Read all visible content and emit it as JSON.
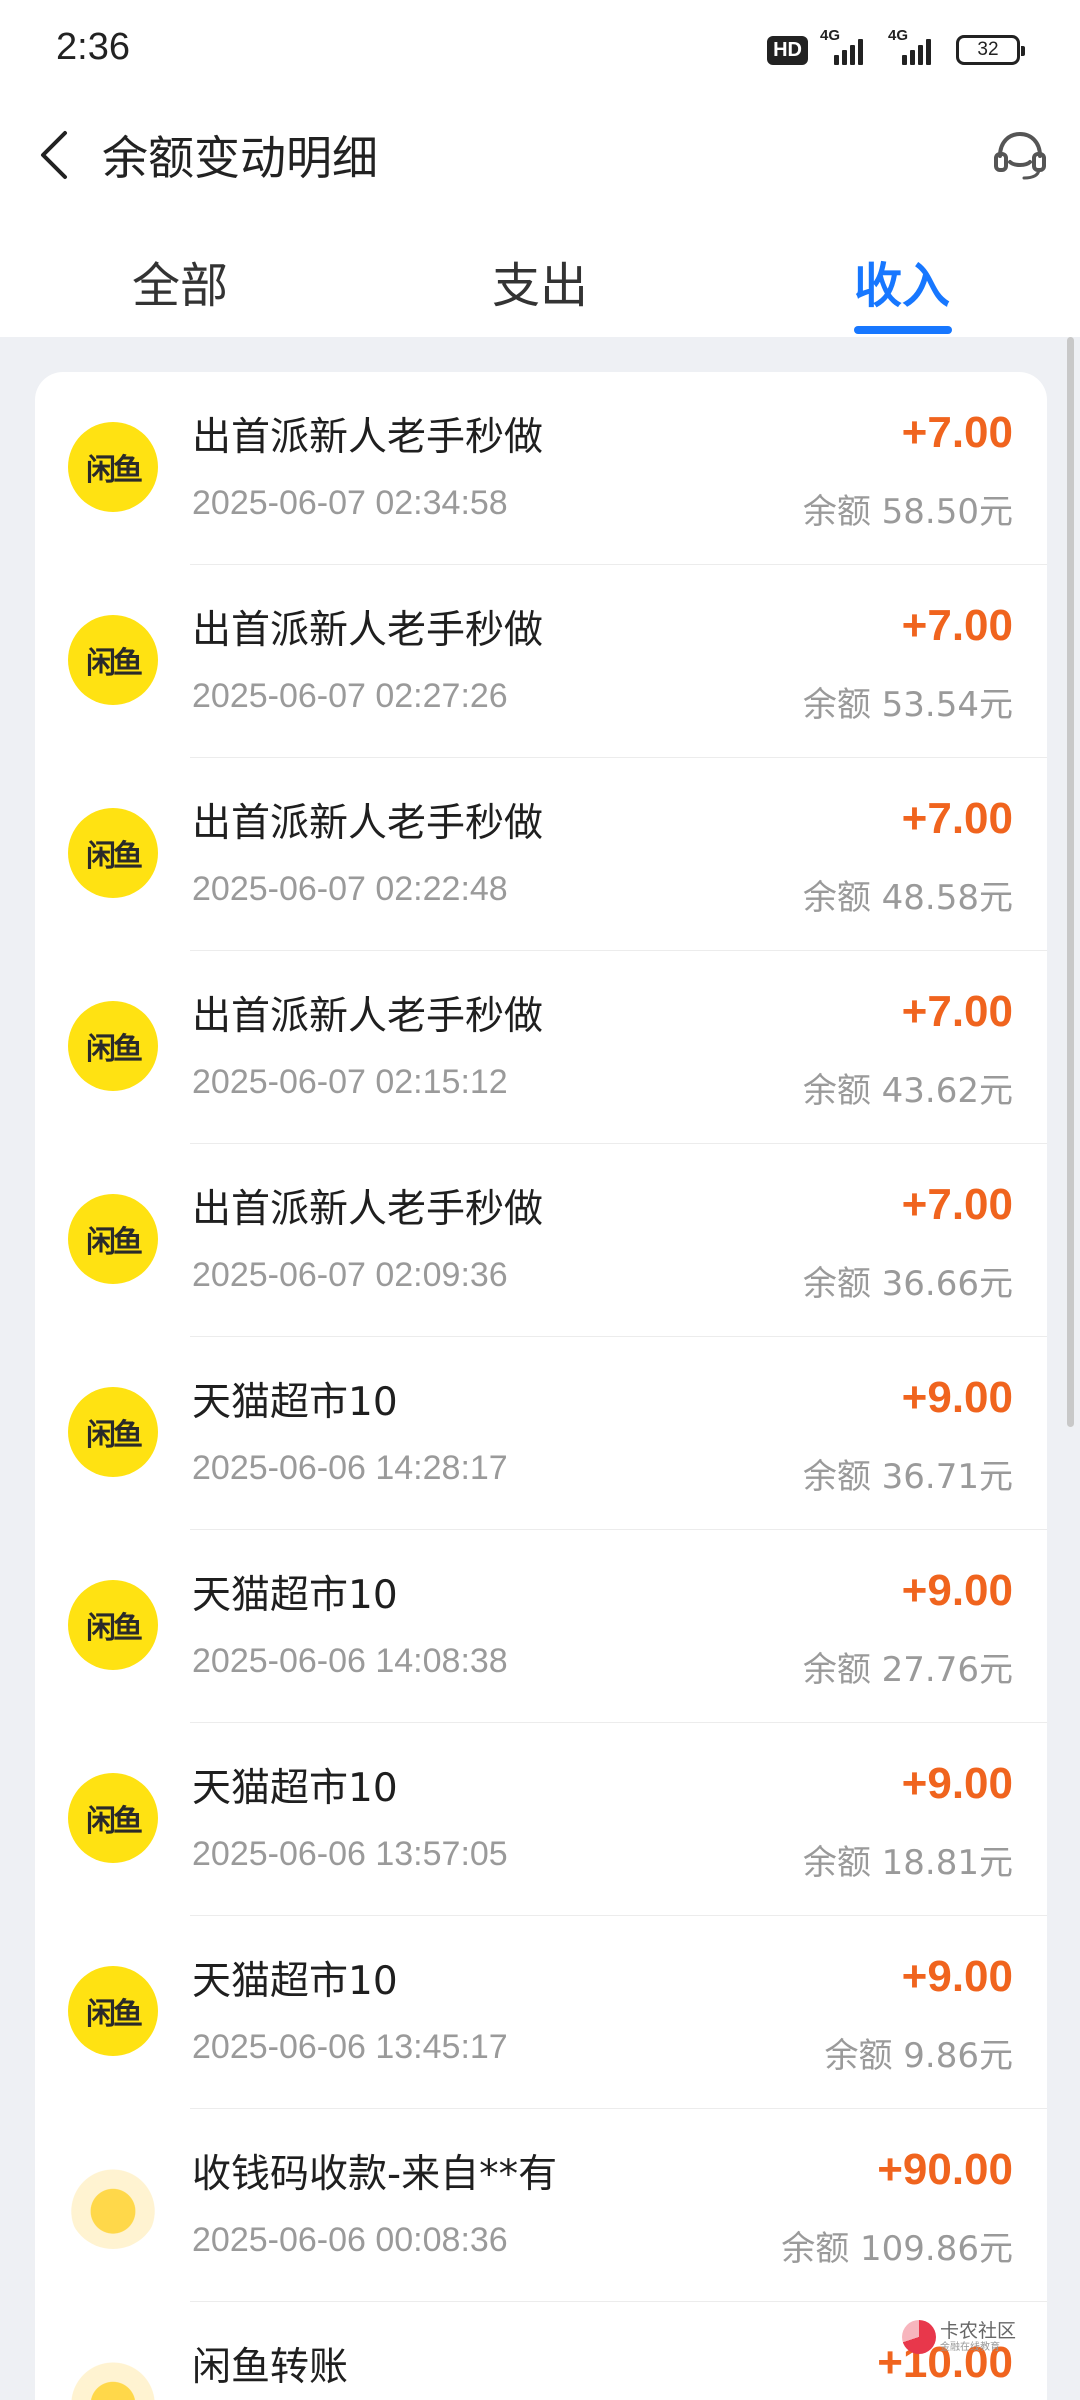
{
  "status_bar": {
    "time": "2:36",
    "hd_label": "HD",
    "signal1_label": "4G",
    "signal2_label": "4G",
    "battery": "32"
  },
  "header": {
    "title": "余额变动明细",
    "back_icon": "chevron-left-icon",
    "service_icon": "headset-icon"
  },
  "tabs": [
    {
      "label": "全部",
      "active": false
    },
    {
      "label": "支出",
      "active": false
    },
    {
      "label": "收入",
      "active": true
    }
  ],
  "colors": {
    "accent": "#1777ff",
    "amount": "#f0641e",
    "xianyu_yellow": "#ffe212"
  },
  "records": [
    {
      "title": "出首派新人老手秒做",
      "time": "2025-06-07 02:34:58",
      "amount": "+7.00",
      "balance": "余额 58.50元",
      "avatar": "xianyu"
    },
    {
      "title": "出首派新人老手秒做",
      "time": "2025-06-07 02:27:26",
      "amount": "+7.00",
      "balance": "余额 53.54元",
      "avatar": "xianyu"
    },
    {
      "title": "出首派新人老手秒做",
      "time": "2025-06-07 02:22:48",
      "amount": "+7.00",
      "balance": "余额 48.58元",
      "avatar": "xianyu"
    },
    {
      "title": "出首派新人老手秒做",
      "time": "2025-06-07 02:15:12",
      "amount": "+7.00",
      "balance": "余额 43.62元",
      "avatar": "xianyu"
    },
    {
      "title": "出首派新人老手秒做",
      "time": "2025-06-07 02:09:36",
      "amount": "+7.00",
      "balance": "余额 36.66元",
      "avatar": "xianyu"
    },
    {
      "title": "天猫超市10",
      "time": "2025-06-06 14:28:17",
      "amount": "+9.00",
      "balance": "余额 36.71元",
      "avatar": "xianyu"
    },
    {
      "title": "天猫超市10",
      "time": "2025-06-06 14:08:38",
      "amount": "+9.00",
      "balance": "余额 27.76元",
      "avatar": "xianyu"
    },
    {
      "title": "天猫超市10",
      "time": "2025-06-06 13:57:05",
      "amount": "+9.00",
      "balance": "余额 18.81元",
      "avatar": "xianyu"
    },
    {
      "title": "天猫超市10",
      "time": "2025-06-06 13:45:17",
      "amount": "+9.00",
      "balance": "余额 9.86元",
      "avatar": "xianyu"
    },
    {
      "title": "收钱码收款-来自**有",
      "time": "2025-06-06 00:08:36",
      "amount": "+90.00",
      "balance": "余额 109.86元",
      "avatar": "duck"
    },
    {
      "title": "闲鱼转账",
      "time": "",
      "amount": "+10.00",
      "balance": "",
      "avatar": "duck"
    }
  ],
  "xianyu_mark": "闲鱼",
  "watermark": {
    "text": "卡农社区",
    "sub": "金融在线教育"
  }
}
